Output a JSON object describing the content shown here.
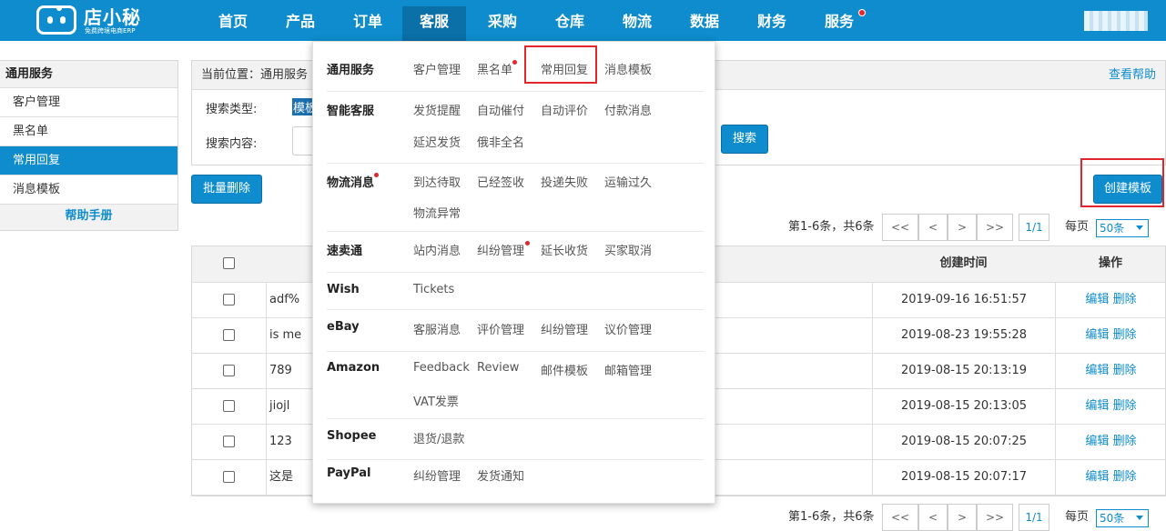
{
  "app": {
    "logo_title": "店小秘",
    "logo_subtitle": "免费跨境电商ERP"
  },
  "nav": [
    {
      "label": "首页"
    },
    {
      "label": "产品"
    },
    {
      "label": "订单"
    },
    {
      "label": "客服",
      "active": true
    },
    {
      "label": "采购"
    },
    {
      "label": "仓库"
    },
    {
      "label": "物流"
    },
    {
      "label": "数据"
    },
    {
      "label": "财务"
    },
    {
      "label": "服务",
      "badge": true
    }
  ],
  "sidebar": {
    "header": "通用服务",
    "items": [
      {
        "label": "客户管理"
      },
      {
        "label": "黑名单"
      },
      {
        "label": "常用回复",
        "active": true
      },
      {
        "label": "消息模板"
      }
    ],
    "help": "帮助手册"
  },
  "breadcrumb": {
    "label": "当前位置：通用服务",
    "help_link": "查看帮助"
  },
  "search": {
    "type_label": "搜索类型:",
    "type_value": "模板",
    "content_label": "搜索内容:",
    "button": "搜索"
  },
  "toolbar": {
    "batch_delete": "批量删除",
    "create_template": "创建模板"
  },
  "pagination": {
    "info": "第1-6条，共6条",
    "first": "<<",
    "prev": "<",
    "next": ">",
    "last": ">>",
    "current": "1/1",
    "per_page_label": "每页",
    "per_page_value": "50条"
  },
  "table": {
    "headers": {
      "created": "创建时间",
      "actions": "操作"
    },
    "rows": [
      {
        "name": "adf%",
        "created": "2019-09-16 16:51:57",
        "edit": "编辑",
        "delete": "删除"
      },
      {
        "name": "is me",
        "created": "2019-08-23 19:55:28",
        "edit": "编辑",
        "delete": "删除"
      },
      {
        "name": "789",
        "created": "2019-08-15 20:13:19",
        "edit": "编辑",
        "delete": "删除"
      },
      {
        "name": "jiojl",
        "created": "2019-08-15 20:13:05",
        "edit": "编辑",
        "delete": "删除"
      },
      {
        "name": "123",
        "created": "2019-08-15 20:07:25",
        "edit": "编辑",
        "delete": "删除"
      },
      {
        "name": "这是",
        "created": "2019-08-15 20:07:17",
        "edit": "编辑",
        "delete": "删除"
      }
    ]
  },
  "menu": {
    "groups": [
      {
        "title": "通用服务",
        "links": [
          "客户管理",
          "黑名单",
          "常用回复",
          "消息模板"
        ]
      },
      {
        "title": "智能客服",
        "links": [
          "发货提醒",
          "自动催付",
          "自动评价",
          "付款消息",
          "延迟发货",
          "俄非全名"
        ]
      },
      {
        "title": "物流消息",
        "links": [
          "到达待取",
          "已经签收",
          "投递失败",
          "运输过久",
          "物流异常"
        ]
      },
      {
        "title": "速卖通",
        "links": [
          "站内消息",
          "纠纷管理",
          "延长收货",
          "买家取消"
        ]
      },
      {
        "title": "Wish",
        "links": [
          "Tickets"
        ]
      },
      {
        "title": "eBay",
        "links": [
          "客服消息",
          "评价管理",
          "纠纷管理",
          "议价管理"
        ]
      },
      {
        "title": "Amazon",
        "links": [
          "Feedback",
          "Review",
          "邮件模板",
          "邮箱管理",
          "VAT发票"
        ]
      },
      {
        "title": "Shopee",
        "links": [
          "退货/退款"
        ]
      },
      {
        "title": "PayPal",
        "links": [
          "纠纷管理",
          "发货通知"
        ]
      }
    ]
  },
  "colors": {
    "primary": "#0e8ccd",
    "highlight": "#e3262d",
    "badge": "#e8262a"
  }
}
